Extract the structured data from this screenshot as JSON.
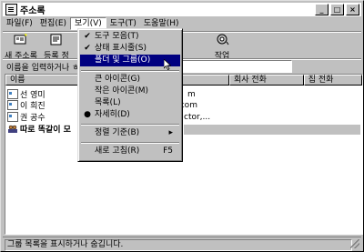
{
  "window": {
    "title": "주소록"
  },
  "menubar": [
    {
      "label": "파일(F)"
    },
    {
      "label": "편집(E)"
    },
    {
      "label": "보기(V)"
    },
    {
      "label": "도구(T)"
    },
    {
      "label": "도움말(H)"
    }
  ],
  "toolbar": {
    "new_label": "새 주소록",
    "props_label": "등록 정",
    "action_label": "작업"
  },
  "search": {
    "label": "이름을 입력하거나 ㅎ",
    "value": ""
  },
  "columns": [
    "이름",
    "회사 전화",
    "집 전화"
  ],
  "rows": [
    {
      "name": "선 영미",
      "email": "m"
    },
    {
      "name": "이 희진",
      "email": "r.com"
    },
    {
      "name": "권 공수",
      "email": "ctor,..."
    },
    {
      "name": "따로 똑같이 모",
      "email": ""
    }
  ],
  "status": {
    "text": "그룹 목록을 표시하거나 숨깁니다."
  },
  "view_menu": [
    {
      "label": "도구 모음(T)",
      "mark": "✔"
    },
    {
      "label": "상태 표시줄(S)",
      "mark": "✔"
    },
    {
      "label": "폴더 및 그룹(O)",
      "mark": "",
      "highlight": true
    },
    {
      "label": "큰 아이콘(G)",
      "mark": ""
    },
    {
      "label": "작은 아이콘(M)",
      "mark": ""
    },
    {
      "label": "목록(L)",
      "mark": ""
    },
    {
      "label": "자세히(D)",
      "mark": "●"
    },
    {
      "label": "정렬 기준(B)",
      "mark": "",
      "submenu": "▸"
    },
    {
      "label": "새로 고침(R)",
      "mark": "",
      "shortcut": "F5"
    }
  ]
}
